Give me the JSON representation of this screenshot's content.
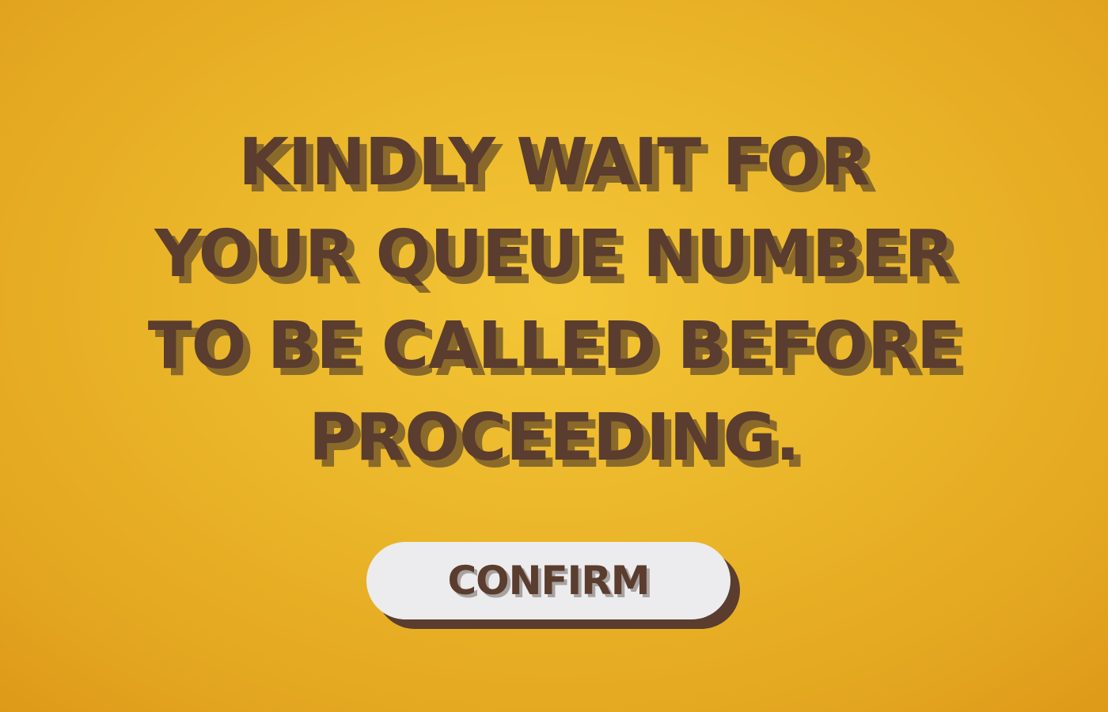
{
  "message": {
    "lines": [
      "KINDLY WAIT FOR",
      "YOUR QUEUE NUMBER",
      "TO BE CALLED BEFORE",
      "PROCEEDING."
    ]
  },
  "confirm_button": {
    "label": "CONFIRM"
  },
  "colors": {
    "background": "#eab529",
    "text": "#5a3d2e",
    "button": "#ececee"
  }
}
